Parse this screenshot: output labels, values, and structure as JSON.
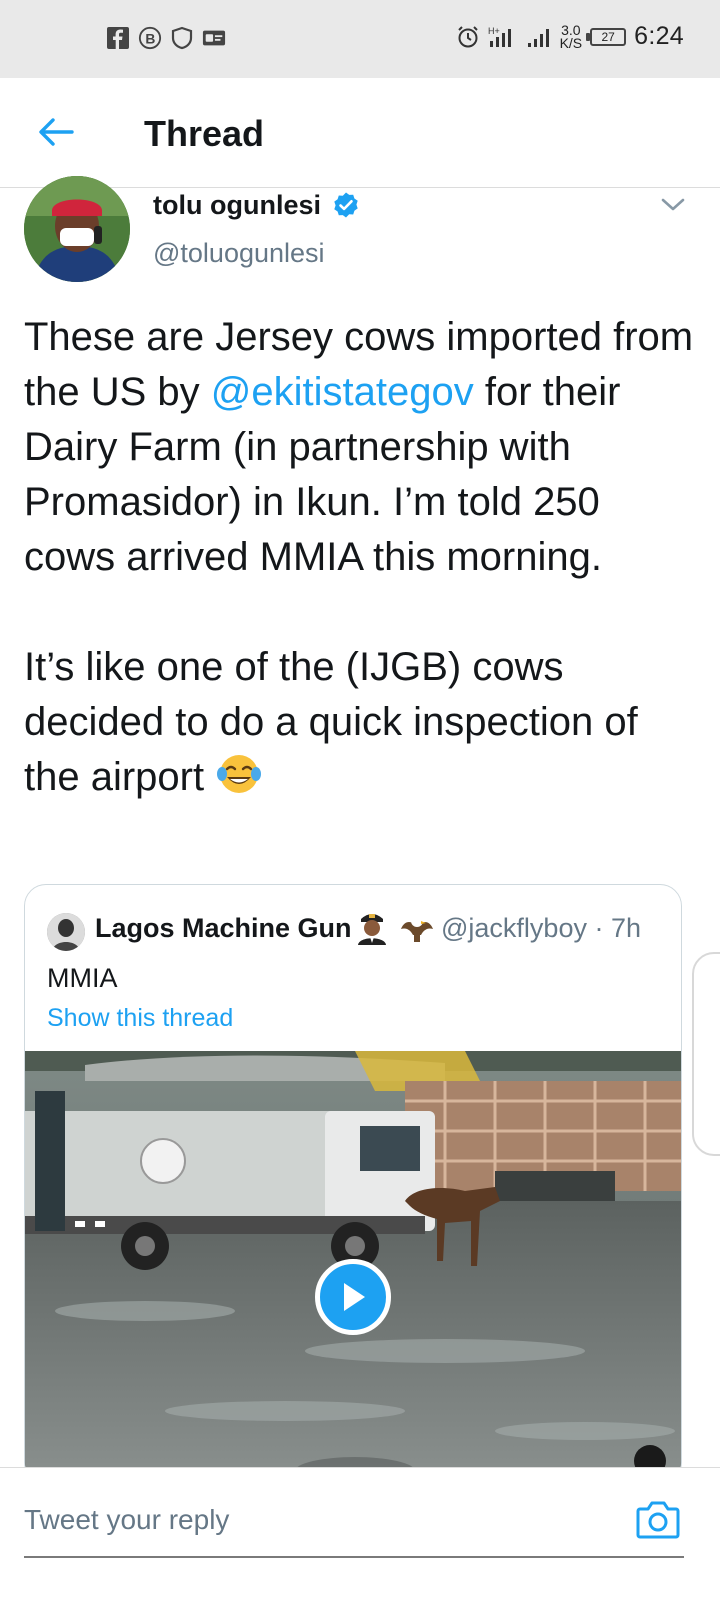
{
  "status_bar": {
    "time": "6:24",
    "speed_value": "3.0",
    "speed_unit": "K/S",
    "battery": "27",
    "left_icons": [
      "facebook-icon",
      "b-icon",
      "shield-icon",
      "card-icon"
    ],
    "right_icons": [
      "alarm-icon",
      "signal-icon",
      "signal-icon",
      "battery-icon"
    ]
  },
  "header": {
    "title": "Thread",
    "back_icon": "arrow-left-icon"
  },
  "tweet": {
    "author_name": "tolu ogunlesi",
    "author_handle": "@toluogunlesi",
    "verified": true,
    "text_part1": "These are Jersey cows imported from the US by ",
    "mention": "@ekitistategov",
    "text_part2": " for their Dairy Farm (in partnership with Promasidor) in Ikun. I’m told 250 cows arrived MMIA this morning.",
    "text_part3": "It’s like one of the (IJGB) cows decided to do a quick inspection of the airport ",
    "emoji": "face-with-tears-of-joy"
  },
  "quoted_tweet": {
    "author_name": "Lagos Machine Gun",
    "emoji1": "pilot",
    "emoji2": "eagle",
    "handle_time": "@jackflyboy · 7h",
    "text": "MMIA",
    "show_thread": "Show this thread",
    "media_type": "video"
  },
  "reply": {
    "placeholder": "Tweet your reply",
    "camera_icon": "camera-icon"
  },
  "colors": {
    "accent": "#1da1f2",
    "secondary_text": "#657786",
    "primary_text": "#14171a"
  }
}
